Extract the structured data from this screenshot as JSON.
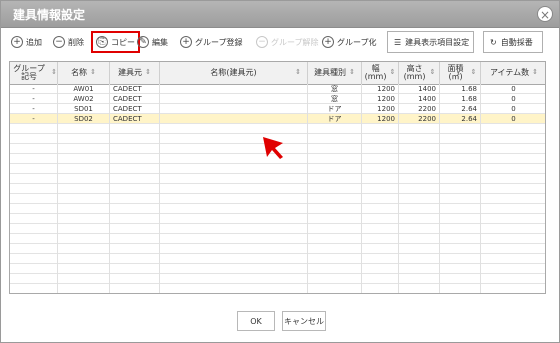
{
  "window": {
    "title": "建具情報設定",
    "close_symbol": "×"
  },
  "toolbar": {
    "add": "追加",
    "delete": "削除",
    "copy": "コピー",
    "edit": "編集",
    "group_register": "グループ登録",
    "group_release": "グループ解除",
    "group": "グループ化",
    "display_settings": "建具表示項目設定",
    "auto_arrange": "自動採番"
  },
  "table": {
    "headers": [
      "グループ記号",
      "名称",
      "建具元",
      "名称(建具元)",
      "建具種別",
      "幅(mm)",
      "高さ(mm)",
      "面積(㎡)",
      "アイテム数"
    ],
    "rows": [
      [
        "-",
        "AW01",
        "CADECT",
        "",
        "窓",
        "1200",
        "1400",
        "1.68",
        "0"
      ],
      [
        "-",
        "AW02",
        "CADECT",
        "",
        "窓",
        "1200",
        "1400",
        "1.68",
        "0"
      ],
      [
        "-",
        "SD01",
        "CADECT",
        "",
        "ドア",
        "1200",
        "2200",
        "2.64",
        "0"
      ],
      [
        "-",
        "SD02",
        "CADECT",
        "",
        "ドア",
        "1200",
        "2200",
        "2.64",
        "0"
      ]
    ],
    "selected_row_index": 3
  },
  "footer": {
    "ok": "OK",
    "cancel": "キャンセル"
  },
  "colors": {
    "title_bar": "#a8a8a8",
    "highlight_border": "#e00000",
    "selected_row": "#fff4c8",
    "cursor": "#e00000"
  }
}
